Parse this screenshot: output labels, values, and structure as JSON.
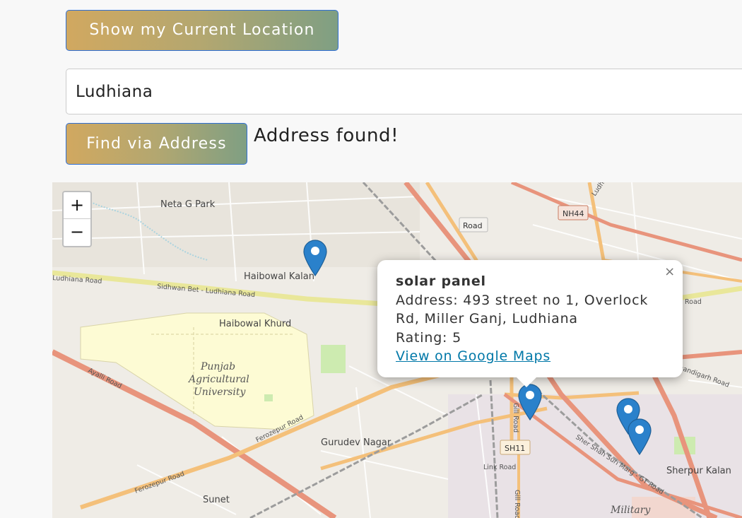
{
  "controls": {
    "current_location_label": "Show my Current Location",
    "address_value": "Ludhiana",
    "find_label": "Find via Address",
    "status_text": "Address found!"
  },
  "map": {
    "zoom_in": "+",
    "zoom_out": "−",
    "places": {
      "neta_g_park": "Neta G Park",
      "haibowal_kalan": "Haibowal Kalan",
      "haibowal_khurd": "Haibowal Khurd",
      "pau_line1": "Punjab",
      "pau_line2": "Agricultural",
      "pau_line3": "University",
      "gurudev_nagar": "Gurudev Nagar",
      "sunet": "Sunet",
      "sherpur_kalan": "Sherpur Kalan",
      "military": "Military"
    },
    "roads": {
      "ludhiana_road_left": "Ludhiana Road",
      "sidhwan_bet": "Sidhwan Bet - Ludhiana Road",
      "ayalli_road": "Ayalli Road",
      "ferozepur_road_1": "Ferozepur Road",
      "ferozepur_road_2": "Ferozepur Road",
      "link_road": "Link Road",
      "gill_road_1": "Gill Road",
      "gill_road_2": "Gill Road",
      "sher_shah_suri": "Sher Shah Suri Marg - GT Road",
      "chandigarh_road": "Chandigarh Road",
      "road_right": "Road",
      "ludhiana_top": "Ludhia"
    },
    "shields": {
      "nh44": "NH44",
      "sh11": "SH11",
      "road_box": "Road"
    },
    "popup": {
      "title": "solar panel",
      "address": "Address: 493 street no 1, Overlock Rd, Miller Ganj, Ludhiana",
      "rating": "Rating: 5",
      "link": "View on Google Maps",
      "close": "×"
    },
    "marker_color": "#2a81cb"
  }
}
